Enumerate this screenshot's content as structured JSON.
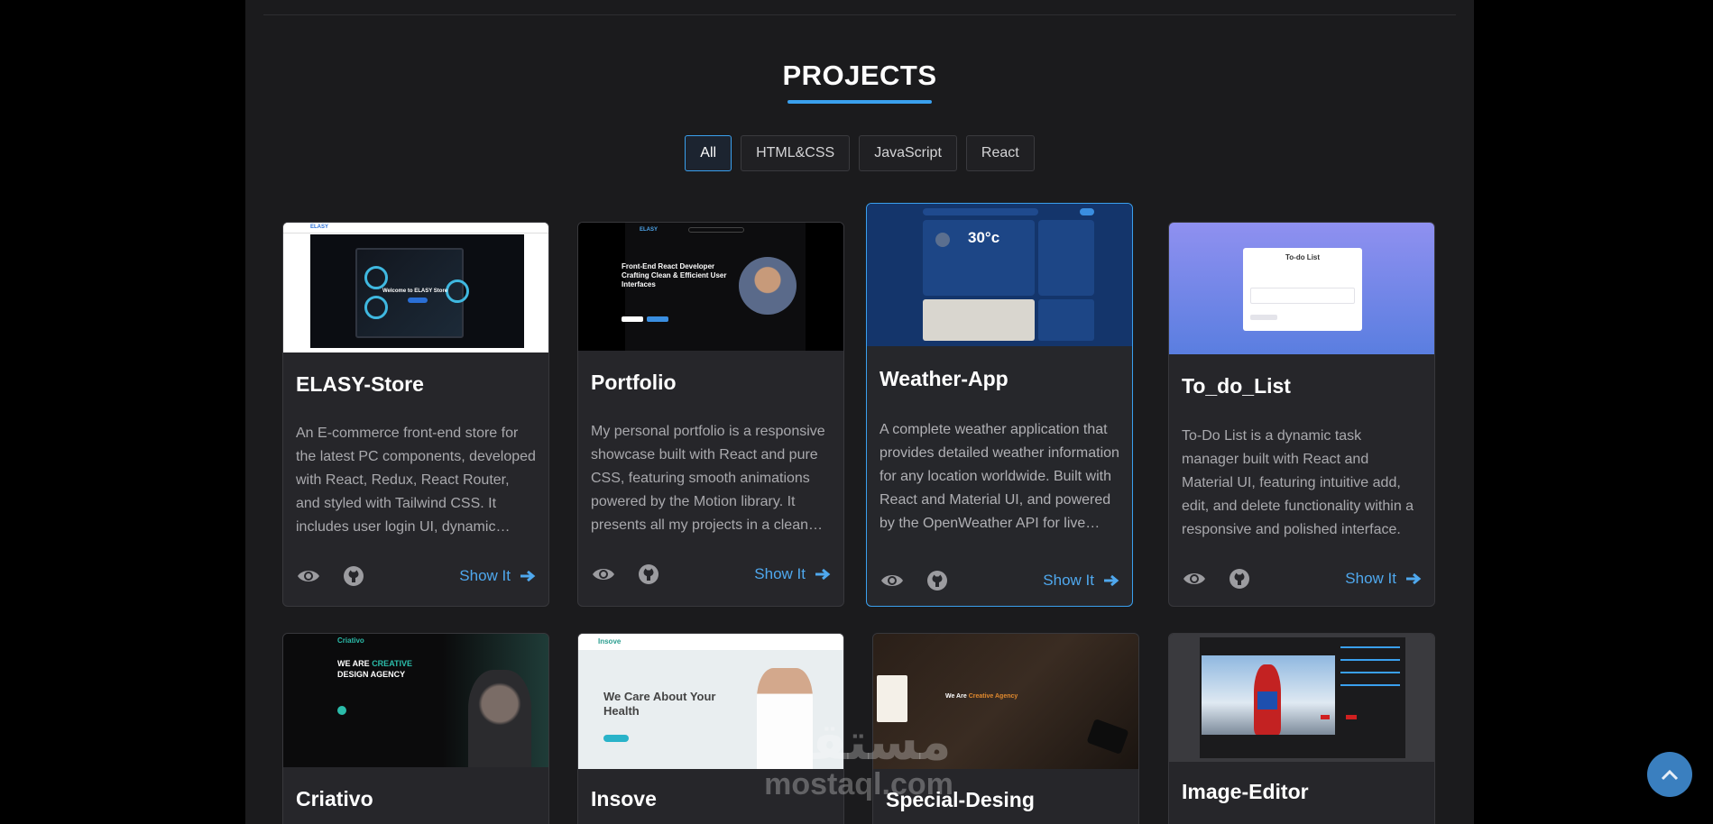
{
  "section": {
    "title": "PROJECTS"
  },
  "filters": [
    "All",
    "HTML&CSS",
    "JavaScript",
    "React"
  ],
  "active_filter": "All",
  "colors": {
    "accent": "#3aa0ee",
    "background": "#1b1b1d",
    "card": "#26262a",
    "link": "#4fa8ee"
  },
  "cards": [
    {
      "title": "ELASY-Store",
      "description": "An E-commerce front-end store for the latest PC components, developed with React, Redux, React Router, and styled with Tailwind CSS. It includes user login UI, dynamic product listings and a responsive cart.",
      "show_label": "Show It",
      "thumb": {
        "brand": "ELASY",
        "headline": "Welcome to ELASY Store"
      }
    },
    {
      "title": "Portfolio",
      "description": "My personal portfolio is a responsive showcase built with React and pure CSS, featuring smooth animations powered by the Motion library. It presents all my projects in a clean and modern layout.",
      "show_label": "Show It",
      "thumb": {
        "brand": "ELASY",
        "headline": "Front-End React Developer Crafting Clean & Efficient User Interfaces"
      }
    },
    {
      "title": "Weather-App",
      "description": "A complete weather application that provides detailed weather information for any location worldwide. Built with React and Material UI, and powered by the OpenWeather API for live forecasts.",
      "show_label": "Show It",
      "thumb": {
        "temperature": "30°c"
      }
    },
    {
      "title": "To_do_List",
      "description": "To-Do List is a dynamic task manager built with React and Material UI, featuring intuitive add, edit, and delete functionality within a responsive and polished interface.",
      "show_label": "Show It",
      "thumb": {
        "headline": "To-do List"
      }
    },
    {
      "title": "Criativo",
      "thumb": {
        "brand": "Criativo",
        "headline_a": "WE ARE",
        "headline_b": "CREATIVE",
        "headline_c": "DESIGN AGENCY"
      }
    },
    {
      "title": "Insove",
      "thumb": {
        "brand": "Insove",
        "headline": "We Care About Your Health"
      }
    },
    {
      "title": "Special-Desing",
      "thumb": {
        "headline_a": "We Are",
        "headline_b": "Creative Agency"
      }
    },
    {
      "title": "Image-Editor",
      "thumb": {}
    }
  ],
  "icons": {
    "preview": "eye-icon",
    "repo": "github-icon",
    "arrow": "arrow-right-icon",
    "scroll": "chevron-up-icon"
  },
  "watermark": {
    "arabic": "مستقل",
    "latin": "mostaql.com"
  }
}
